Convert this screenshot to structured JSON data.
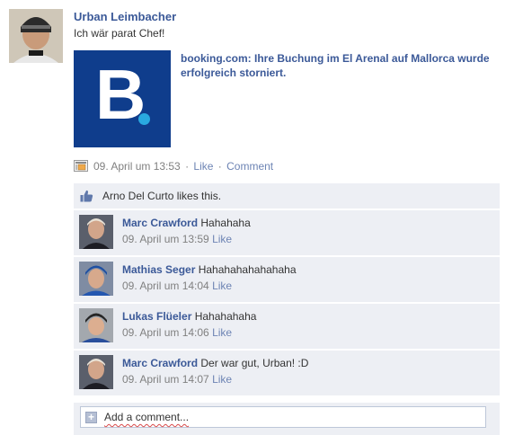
{
  "post": {
    "author": "Urban Leimbacher",
    "message": "Ich wär parat Chef!",
    "attachment_title": "booking.com: Ihre Buchung im El Arenal auf Mallorca wurde erfolgreich storniert.",
    "logo_letter": "B",
    "timestamp": "09. April um 13:53",
    "separator": "·",
    "like_label": "Like",
    "comment_label": "Comment"
  },
  "likes": {
    "text": "Arno Del Curto likes this."
  },
  "comments": [
    {
      "author": "Marc Crawford",
      "text": "Hahahaha",
      "time": "09. April um 13:59",
      "like": "Like"
    },
    {
      "author": "Mathias Seger",
      "text": "Hahahahahahahaha",
      "time": "09. April um 14:04",
      "like": "Like"
    },
    {
      "author": "Lukas Flüeler",
      "text": "Hahahahaha",
      "time": "09. April um 14:06",
      "like": "Like"
    },
    {
      "author": "Marc Crawford",
      "text": "Der war gut, Urban! :D",
      "time": "09. April um 14:07",
      "like": "Like"
    }
  ],
  "add_comment": {
    "placeholder": "Add a comment..."
  },
  "colors": {
    "link": "#3b5998",
    "ufi_background": "#edeff4",
    "booking_blue": "#0f3d8c",
    "booking_dot": "#29a9e0"
  },
  "icons": [
    "poster-avatar-icon",
    "share-app-icon",
    "thumbs-up-icon",
    "plus-icon"
  ]
}
